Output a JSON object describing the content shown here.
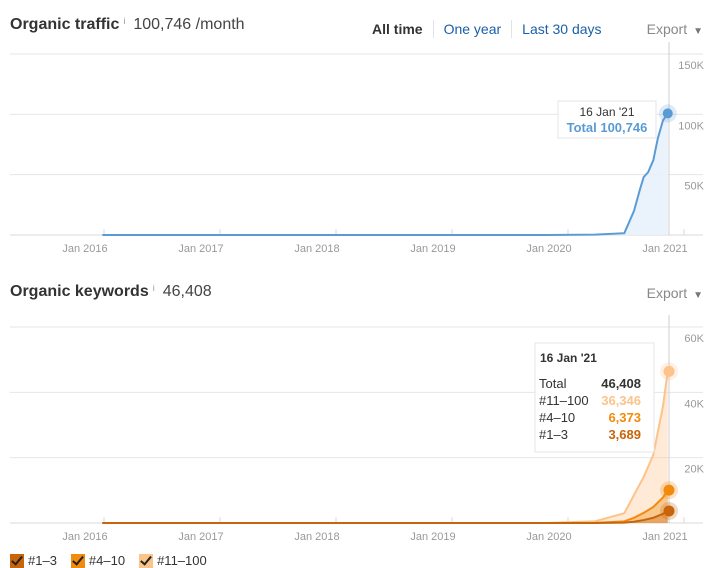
{
  "traffic": {
    "title": "Organic traffic",
    "info_icon": "i",
    "value": "100,746 /month",
    "ranges": [
      {
        "label": "All time",
        "active": true
      },
      {
        "label": "One year",
        "active": false
      },
      {
        "label": "Last 30 days",
        "active": false
      }
    ],
    "export_label": "Export",
    "tooltip": {
      "date": "16 Jan '21",
      "total_label": "Total 100,746"
    }
  },
  "keywords": {
    "title": "Organic keywords",
    "info_icon": "i",
    "value": "46,408",
    "export_label": "Export",
    "tooltip": {
      "date": "16 Jan '21",
      "rows": [
        {
          "label": "Total",
          "value": "46,408",
          "color": "#333333"
        },
        {
          "label": "#11–100",
          "value": "36,346",
          "color": "#fcc38a"
        },
        {
          "label": "#4–10",
          "value": "6,373",
          "color": "#f28a0c"
        },
        {
          "label": "#1–3",
          "value": "3,689",
          "color": "#c8650a"
        }
      ]
    },
    "legend": [
      {
        "label": "#1–3",
        "color": "#c8650a"
      },
      {
        "label": "#4–10",
        "color": "#f28a0c"
      },
      {
        "label": "#11–100",
        "color": "#fcc38a"
      }
    ]
  },
  "colors": {
    "traffic_line": "#5b9bd5",
    "traffic_fill": "#e8f1fb",
    "grid": "#e6e6e6",
    "axis_text": "#999999"
  },
  "chart_data": [
    {
      "type": "area",
      "title": "Organic traffic",
      "xlabel": "",
      "ylabel": "",
      "x_ticks": [
        "Jan 2016",
        "Jan 2017",
        "Jan 2018",
        "Jan 2019",
        "Jan 2020",
        "Jan 2021"
      ],
      "y_ticks": [
        "50K",
        "100K",
        "150K"
      ],
      "ylim": [
        0,
        150000
      ],
      "xlim": [
        "2015-08",
        "2021-02"
      ],
      "grid": true,
      "series": [
        {
          "name": "Total",
          "x": [
            "2016-03",
            "2017-01",
            "2018-01",
            "2019-01",
            "2020-01",
            "2020-06",
            "2020-09",
            "2020-10",
            "2020-10-20",
            "2020-11",
            "2020-11-15",
            "2020-12",
            "2020-12-15",
            "2021-01",
            "2021-01-16"
          ],
          "values": [
            0,
            0,
            0,
            0,
            0,
            300,
            1500,
            20000,
            38000,
            48000,
            52000,
            62000,
            80000,
            95000,
            100746
          ]
        }
      ]
    },
    {
      "type": "area",
      "title": "Organic keywords",
      "xlabel": "",
      "ylabel": "",
      "x_ticks": [
        "Jan 2016",
        "Jan 2017",
        "Jan 2018",
        "Jan 2019",
        "Jan 2020",
        "Jan 2021"
      ],
      "y_ticks": [
        "20K",
        "40K",
        "60K"
      ],
      "ylim": [
        0,
        60000
      ],
      "xlim": [
        "2015-08",
        "2021-02"
      ],
      "grid": true,
      "stacked": true,
      "legend": "bottom-left",
      "series": [
        {
          "name": "#1–3",
          "x": [
            "2016-03",
            "2017-01",
            "2018-01",
            "2019-01",
            "2020-01",
            "2020-06",
            "2020-09",
            "2020-10",
            "2020-11",
            "2020-12",
            "2021-01",
            "2021-01-16"
          ],
          "values": [
            0,
            0,
            0,
            0,
            0,
            0,
            100,
            400,
            900,
            1600,
            2800,
            3689
          ]
        },
        {
          "name": "#4–10",
          "x": [
            "2016-03",
            "2017-01",
            "2018-01",
            "2019-01",
            "2020-01",
            "2020-06",
            "2020-09",
            "2020-10",
            "2020-11",
            "2020-12",
            "2021-01",
            "2021-01-16"
          ],
          "values": [
            0,
            0,
            0,
            0,
            0,
            50,
            400,
            1200,
            2200,
            3300,
            5000,
            6373
          ]
        },
        {
          "name": "#11–100",
          "x": [
            "2016-03",
            "2017-01",
            "2018-01",
            "2019-01",
            "2020-01",
            "2020-06",
            "2020-09",
            "2020-10",
            "2020-11",
            "2020-12",
            "2021-01",
            "2021-01-16"
          ],
          "values": [
            0,
            0,
            0,
            0,
            0,
            500,
            2500,
            7000,
            11000,
            16000,
            28000,
            36346
          ]
        }
      ]
    }
  ]
}
